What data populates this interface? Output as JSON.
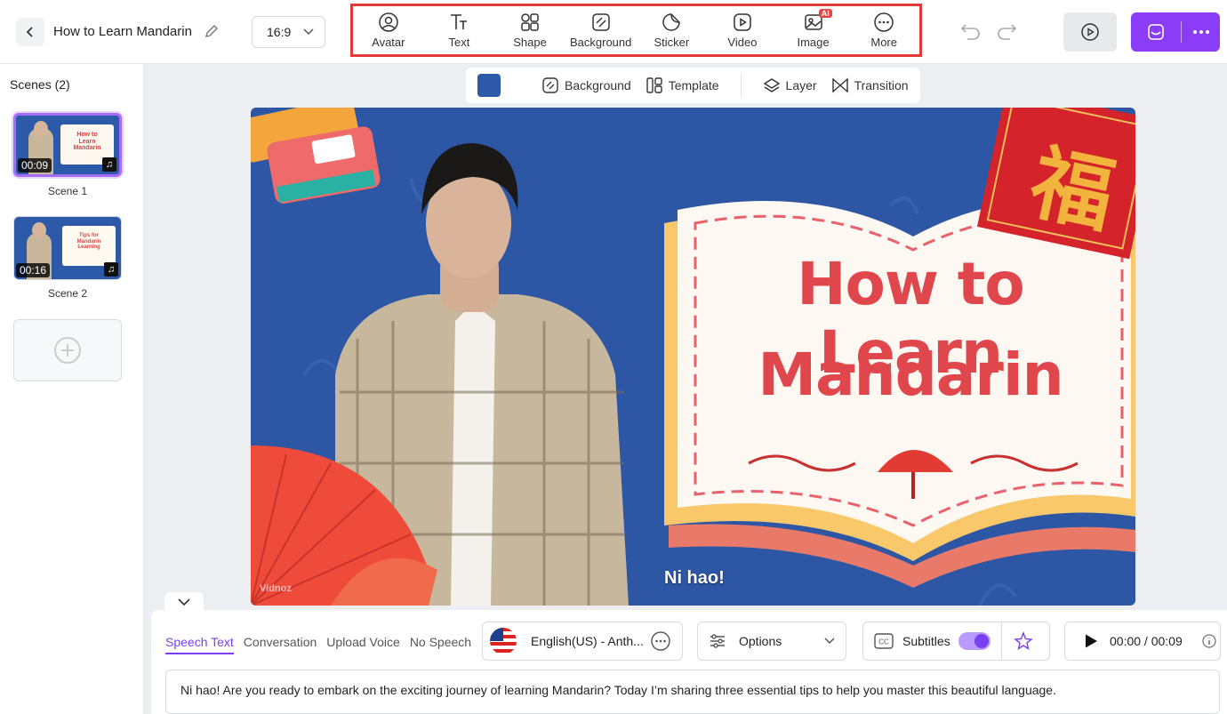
{
  "project": {
    "title": "How to Learn Mandarin",
    "ratio": "16:9"
  },
  "toolbar": [
    {
      "label": "Avatar",
      "icon": "avatar-icon"
    },
    {
      "label": "Text",
      "icon": "text-icon"
    },
    {
      "label": "Shape",
      "icon": "shape-icon"
    },
    {
      "label": "Background",
      "icon": "background-icon"
    },
    {
      "label": "Sticker",
      "icon": "sticker-icon"
    },
    {
      "label": "Video",
      "icon": "video-icon"
    },
    {
      "label": "Image",
      "icon": "image-icon",
      "badge": "AI"
    },
    {
      "label": "More",
      "icon": "more-icon"
    }
  ],
  "sidebar": {
    "title": "Scenes (2)",
    "scenes": [
      {
        "label": "Scene 1",
        "duration": "00:09",
        "thumb_text": "How to Learn Mandarin"
      },
      {
        "label": "Scene 2",
        "duration": "00:16",
        "thumb_text": "Tips for Mandarin Learning"
      }
    ]
  },
  "subbar": {
    "background": "Background",
    "template": "Template",
    "layer": "Layer",
    "transition": "Transition",
    "swatch_color": "#2d5aa8"
  },
  "canvas": {
    "title_line1": "How to Learn",
    "title_line2": "Mandarin",
    "subtitle": "Ni hao!",
    "watermark": "Vidnoz",
    "fu_char": "福",
    "bg_color": "#2d57a5"
  },
  "bottom": {
    "tabs": [
      "Speech Text",
      "Conversation",
      "Upload Voice",
      "No Speech"
    ],
    "voice": "English(US) - Anth...",
    "options": "Options",
    "subtitles": "Subtitles",
    "time": "00:00 / 00:09",
    "speech_text": "Ni hao! Are you ready to embark on the exciting journey of learning Mandarin? Today I’m sharing three essential tips to help you master this beautiful language."
  },
  "colors": {
    "accent": "#8b3cf7",
    "highlight": "#e03a3a"
  }
}
